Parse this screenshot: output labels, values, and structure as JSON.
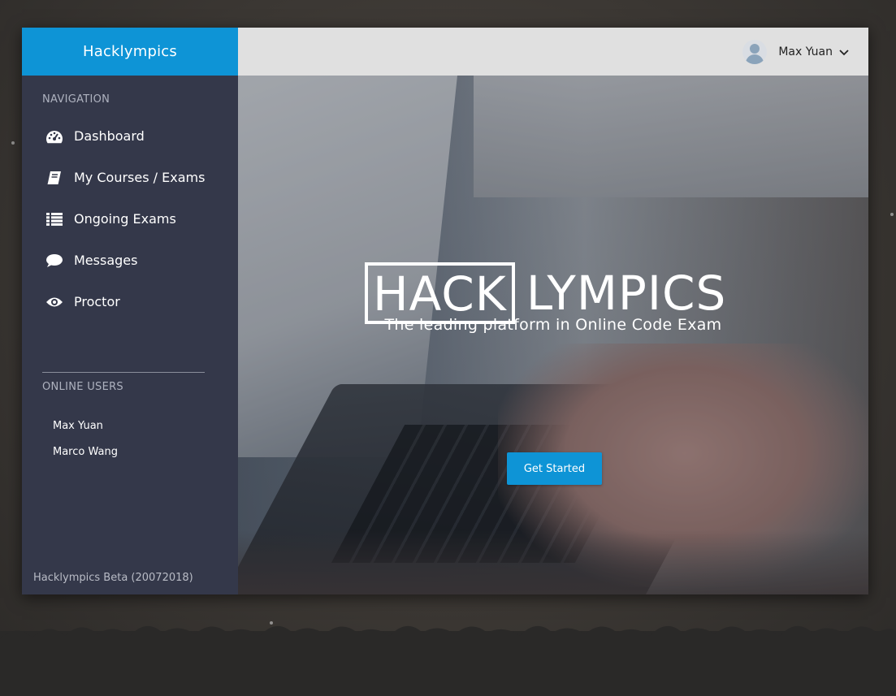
{
  "app": {
    "brand": "Hacklympics",
    "version": "Hacklympics Beta (20072018)"
  },
  "sidebar": {
    "navigation_label": "NAVIGATION",
    "items": [
      {
        "label": "Dashboard",
        "icon": "dashboard-icon"
      },
      {
        "label": "My Courses / Exams",
        "icon": "book-icon"
      },
      {
        "label": "Ongoing Exams",
        "icon": "list-icon"
      },
      {
        "label": "Messages",
        "icon": "comment-icon"
      },
      {
        "label": "Proctor",
        "icon": "eye-icon"
      }
    ],
    "online_users_label": "ONLINE USERS",
    "online_users": [
      "Max Yuan",
      "Marco Wang"
    ]
  },
  "topbar": {
    "user_name": "Max Yuan",
    "avatar_icon": "user-avatar-icon",
    "dropdown_icon": "chevron-down-icon"
  },
  "hero": {
    "logo_boxed": "HACK",
    "logo_rest": "LYMPICS",
    "tagline": "The leading platform in Online Code Exam",
    "cta_label": "Get Started"
  },
  "colors": {
    "accent": "#0e94d6",
    "sidebar_bg": "#34384a",
    "topbar_bg": "#e0e0e0"
  }
}
